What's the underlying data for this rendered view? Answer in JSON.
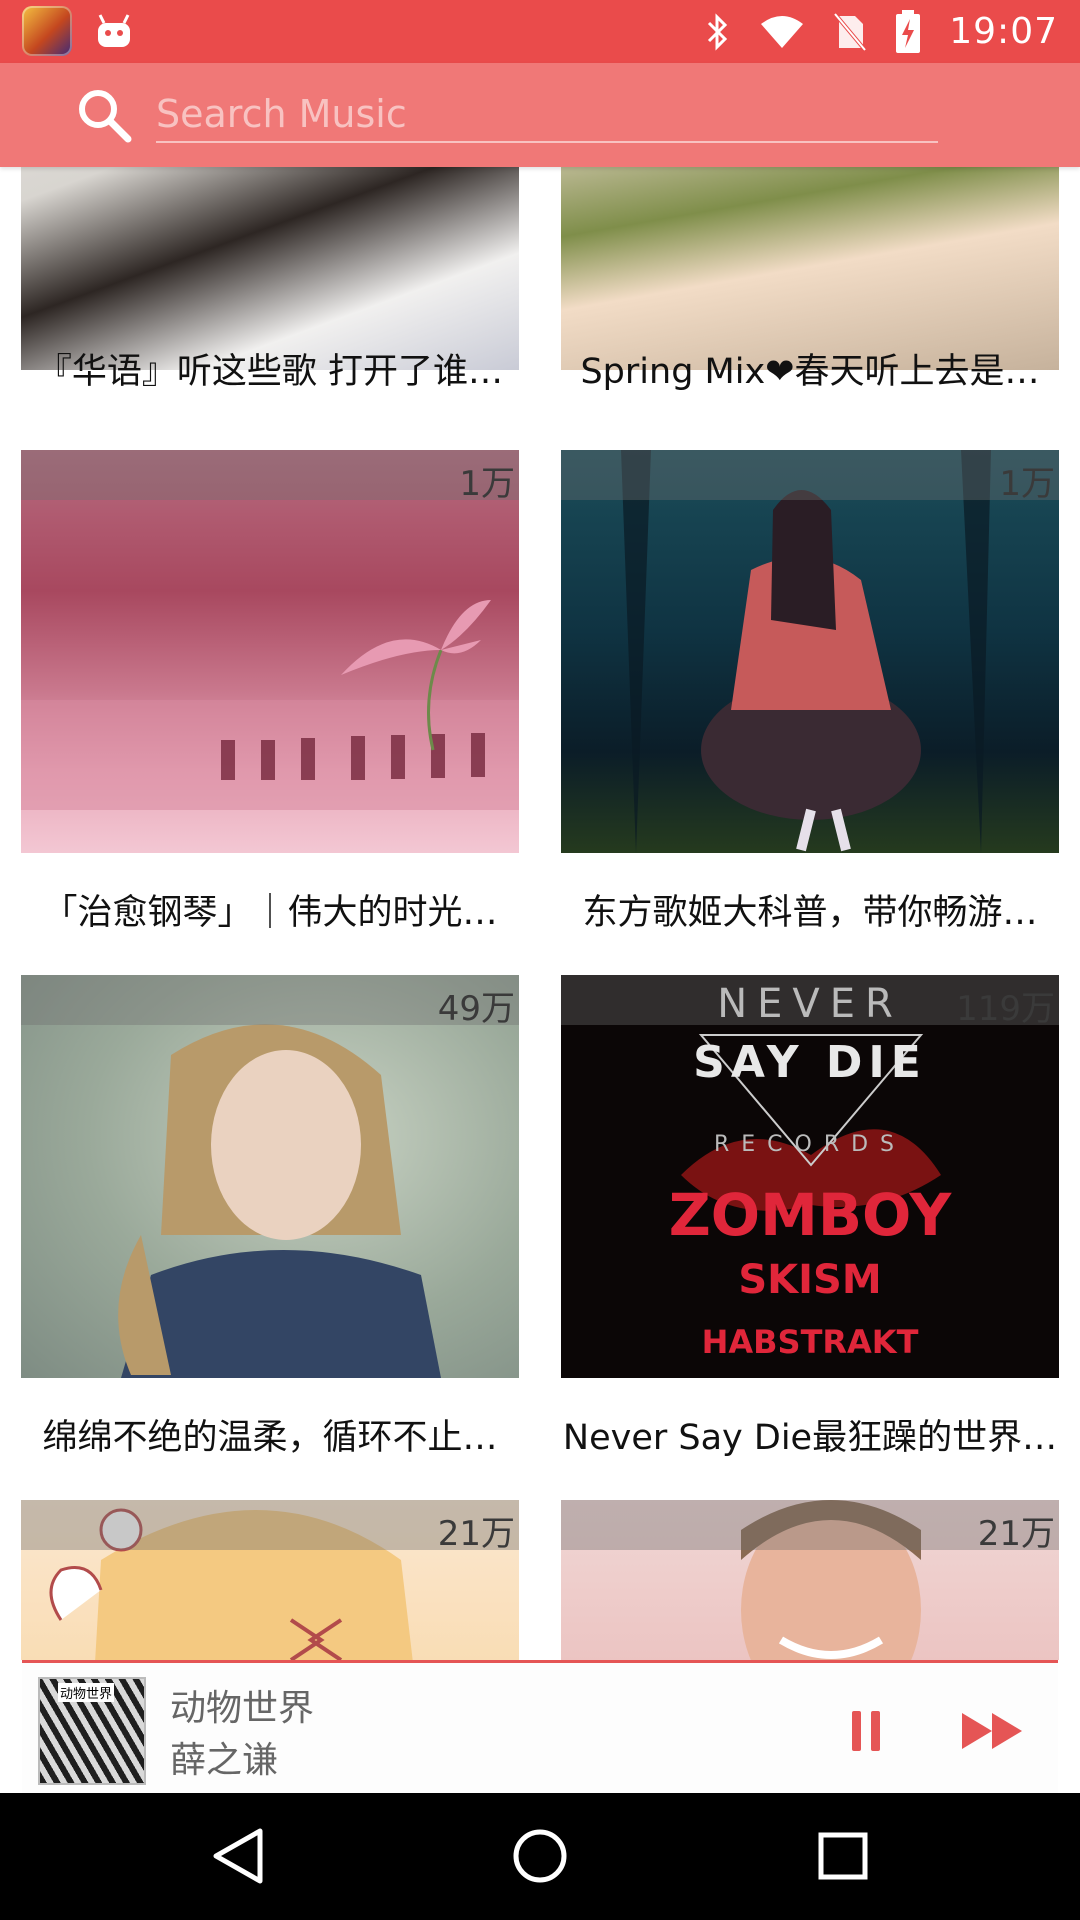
{
  "status_bar": {
    "time": "19:07"
  },
  "search": {
    "placeholder": "Search Music",
    "value": ""
  },
  "playlists": [
    {
      "title": "『华语』听这些歌 打开了谁…",
      "count": ""
    },
    {
      "title": "Spring Mix❤春天听上去是…",
      "count": ""
    },
    {
      "title": "「治愈钢琴」｜伟大的时光…",
      "count": "1万"
    },
    {
      "title": "东方歌姬大科普，带你畅游…",
      "count": "1万"
    },
    {
      "title": "绵绵不绝的温柔，循环不止…",
      "count": "49万"
    },
    {
      "title": "Never Say Die最狂躁的世界…",
      "count": "119万"
    },
    {
      "title": "",
      "count": "21万"
    },
    {
      "title": "",
      "count": "21万"
    }
  ],
  "cover_art_text": {
    "never_say_die": [
      "NEVER",
      "SAY DIE",
      "RECORDS",
      "ZOMBOY",
      "SKISM",
      "HABSTRAKT"
    ]
  },
  "player": {
    "song": "动物世界",
    "artist": "薛之谦",
    "album_art_label": "动物世界"
  },
  "colors": {
    "status_bar": "#ea4b4b",
    "search_bar": "#f07877",
    "accent": "#e55555"
  }
}
